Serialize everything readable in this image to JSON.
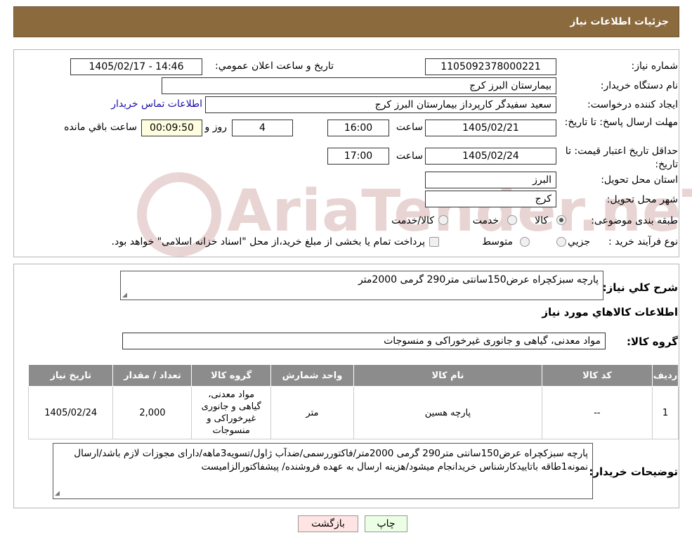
{
  "header": {
    "title": "جزئیات اطلاعات نیاز"
  },
  "form": {
    "need_number_label": "شماره نیاز:",
    "need_number": "1105092378000221",
    "announce_label": "تاریخ و ساعت اعلان عمومي:",
    "announce_value": "1405/02/17 - 14:46",
    "buyer_org_label": "نام دستگاه خريدار:",
    "buyer_org": "بیمارستان البرز کرج",
    "creator_label": "ايجاد کننده درخواست:",
    "creator": "سعید سفیدگر کارپرداز بیمارستان البرز کرج",
    "contact_link": "اطلاعات تماس خريدار",
    "deadline_label": "مهلت ارسال پاسخ: تا تاریخ:",
    "deadline_date": "1405/02/21",
    "time_label": "ساعت",
    "deadline_time": "16:00",
    "days_value": "4",
    "days_label": "روز و",
    "remaining_value": "00:09:50",
    "remaining_label": "ساعت باقي مانده",
    "validity_label": "حداقل تاريخ اعتبار قيمت: تا تاریخ:",
    "validity_date": "1405/02/24",
    "validity_time": "17:00",
    "province_label": "استان محل تحويل:",
    "province": "البرز",
    "city_label": "شهر محل تحويل:",
    "city": "کرج",
    "category_label": "طبقه بندی موضوعی:",
    "category_options": [
      "کالا",
      "خدمت",
      "کالا/خدمت"
    ],
    "category_selected": "کالا",
    "process_label": "نوع فرآيند خريد :",
    "process_options": [
      "جزيي",
      "متوسط"
    ],
    "process_note": "پرداخت تمام يا بخشی از مبلغ خريد،از محل \"اسناد خزانه اسلامی\" خواهد بود."
  },
  "details": {
    "summary_label": "شرح کلي نياز:",
    "summary": "پارچه سبزکچراه عرض150سانتی متر290 گرمی 2000متر",
    "goods_title": "اطلاعات کالاهاي مورد نياز",
    "group_label": "گروه کالا:",
    "group": "مواد معدنی، گیاهی و جانوری غیرخوراکی و منسوجات"
  },
  "table": {
    "headers": [
      "رديف",
      "کد کالا",
      "نام کالا",
      "واحد شمارش",
      "گروه کالا",
      "تعداد / مقدار",
      "تاريخ نياز"
    ],
    "rows": [
      [
        "1",
        "--",
        "پارچه هسین",
        "متر",
        "مواد معدنی، گیاهی و جانوری غیرخوراکی و منسوجات",
        "2,000",
        "1405/02/24"
      ]
    ]
  },
  "notes": {
    "label": "توضيحات خريدار:",
    "text": "پارچه سبزکچراه عرض150سانتی متر290 گرمی 2000متر/فاکتوررسمی/ضدآب ژاول/تسویه3ماهه/دارای مجوزات لازم باشد/ارسال نمونه1طاقه باتاییدکارشناس خریدانجام میشود/هزینه ارسال به عهده فروشنده/ پیشفاکتورالزامیست"
  },
  "buttons": {
    "print": "چاپ",
    "back": "بازگشت"
  },
  "watermark": {
    "text": "AriaTender.neT"
  },
  "colors": {
    "header_bg": "#8b6a3e",
    "table_header_bg": "#8c8c8c",
    "back_button_bg": "#ffe4e4",
    "print_button_bg": "#eaffe4",
    "remaining_bg": "#ffffe0"
  }
}
